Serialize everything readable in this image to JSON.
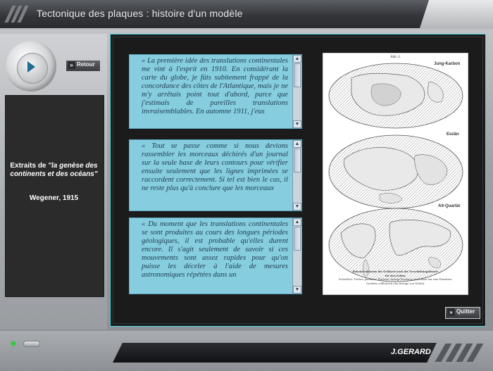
{
  "app": {
    "title": "Tectonique des plaques : histoire d'un modèle",
    "author": "J.GERARD"
  },
  "nav": {
    "back_label": "Retour",
    "quit_label": "Quitter",
    "play_icon": "play-icon",
    "chevron_icon": "double-chevron-icon"
  },
  "sidebar": {
    "extrait_prefix": "Extraits de ",
    "extrait_title": "\"la genèse des continents et des océans\"",
    "author_year": "Wegener, 1915"
  },
  "quotes": [
    {
      "text": "« La première idée des translations continentales me vint à l'esprit en 1910. En considérant la carte du globe, je fûts subitement frappé de la concordance des côtes de l'Atlantique, mais je ne m'y arrêtais point tout d'abord, parce que j'estimais de pareilles translations invraisemblables. En automne 1911, j'eus"
    },
    {
      "text": "« Tout se passe comme si nous devions rassembler les morceaux déchirés d'un journal sur la seule base de leurs contours pour vérifier ensuite seulement que les lignes imprimées se raccordent correctement. Si tel est bien le cas, il ne reste plus qu'à conclure que les morceaux"
    },
    {
      "text": "« Du moment que les translations continentales se sont produites au cours des longues périodes géologiques, il est probable qu'elles durent encore. Il s'agit seulement de savoir si ces mouvements sont assez rapides pour qu'on puisse les déceler à l'aide de mesures astronomiques répétées dans un"
    }
  ],
  "figure": {
    "heading": "Abb. 4.",
    "labels": [
      "Jung-Karbon",
      "Eozän",
      "Alt-Quartär"
    ],
    "caption_1": "Rekonstruktionen der Erdkarte nach der Verschiebungstheorie",
    "caption_2": "für drei Zeiten.",
    "caption_3": "Schraffiert: Tiefsee; punktiert: Flachsee; heutige Konturen und Flüsse nur zum Erkennen.",
    "caption_4": "Gradnetz willkürlich (das heutige von Afrika)."
  },
  "colors": {
    "accent_border": "#4fd7dd",
    "quote_bg": "#86cde0",
    "quote_text": "#1d3a4d",
    "led": "#2ecb3c"
  }
}
